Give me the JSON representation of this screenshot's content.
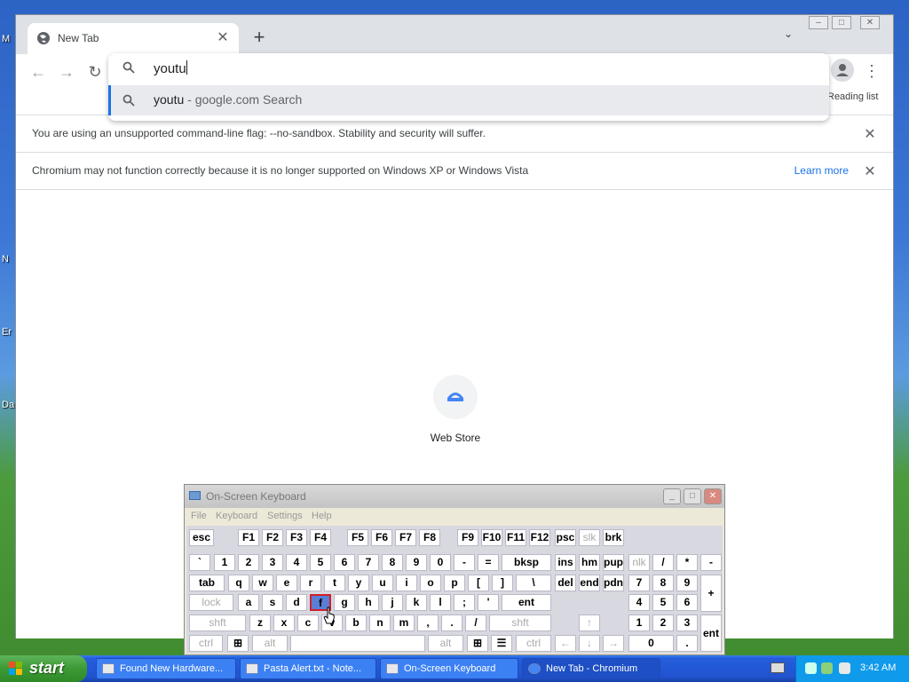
{
  "desktop": {
    "fragments": [
      "M",
      "N",
      "Er",
      "Da"
    ]
  },
  "browser": {
    "tab_title": "New Tab",
    "omnibox_text": "youtu",
    "suggestion_query": "youtu",
    "suggestion_suffix": " - google.com Search",
    "reading_list": "Reading list",
    "infobar_flag": "You are using an unsupported command-line flag: --no-sandbox. Stability and security will suffer.",
    "infobar_os": "Chromium may not function correctly because it is no longer supported on Windows XP or Windows Vista",
    "learn_more": "Learn more",
    "shortcut_label": "Web Store"
  },
  "osk": {
    "title": "On-Screen Keyboard",
    "menu": [
      "File",
      "Keyboard",
      "Settings",
      "Help"
    ],
    "highlighted_key": "f"
  },
  "taskbar": {
    "start": "start",
    "tasks": [
      "Found New Hardware...",
      "Pasta Alert.txt - Note...",
      "On-Screen Keyboard",
      "New Tab - Chromium"
    ],
    "clock": "3:42 AM"
  }
}
